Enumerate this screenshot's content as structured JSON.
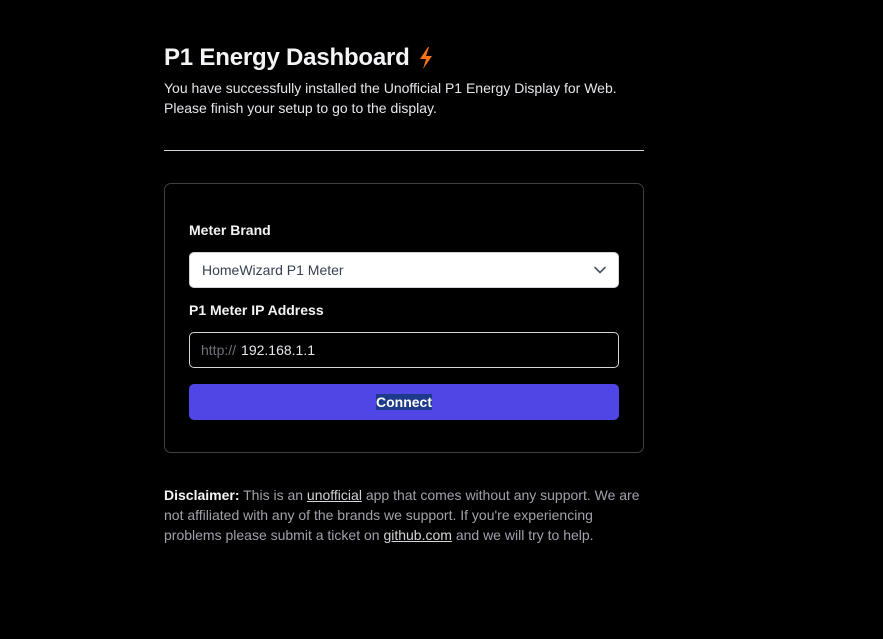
{
  "header": {
    "title": "P1 Energy Dashboard",
    "bolt_icon": "lightning-bolt-icon",
    "intro": "You have successfully installed the Unofficial P1 Energy Display for Web. Please finish your setup to go to the display."
  },
  "form": {
    "brand_label": "Meter Brand",
    "brand_selected": "HomeWizard P1 Meter",
    "ip_label": "P1 Meter IP Address",
    "ip_prefix": "http://",
    "ip_value": "192.168.1.1",
    "connect_label": "Connect"
  },
  "disclaimer": {
    "label": "Disclaimer:",
    "text_1": " This is an ",
    "link_unofficial": "unofficial",
    "text_2": " app that comes without any support. We are not affiliated with any of the brands we support. If you're experiencing problems please submit a ticket on ",
    "link_github": "github.com",
    "text_3": " and we will try to help."
  },
  "colors": {
    "background": "#000000",
    "accent": "#4f46e5",
    "bolt": "#f97316"
  }
}
